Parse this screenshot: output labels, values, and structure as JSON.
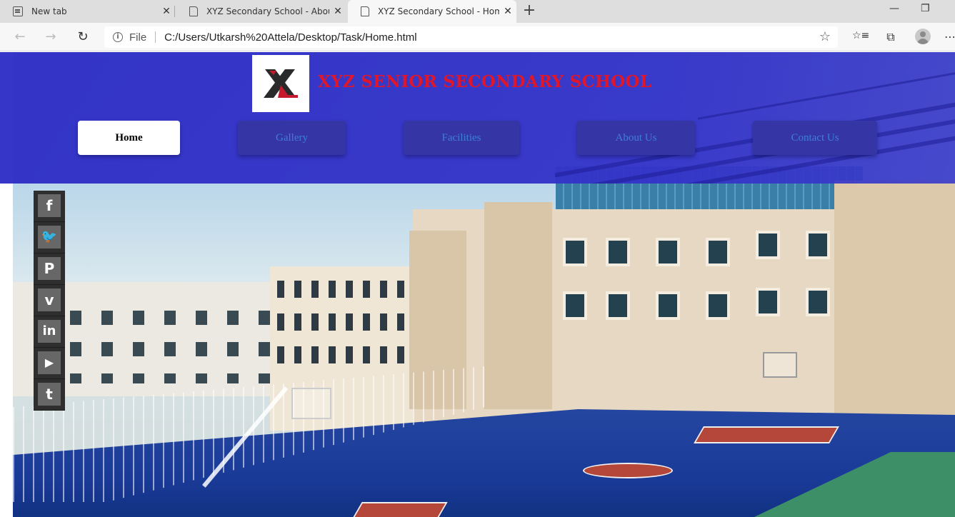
{
  "browser": {
    "tabs": [
      {
        "title": "New tab",
        "icon": "newtab-icon",
        "active": false
      },
      {
        "title": "XYZ Secondary School - About U",
        "icon": "document-icon",
        "active": false
      },
      {
        "title": "XYZ Secondary School - Home",
        "icon": "document-icon",
        "active": true
      }
    ],
    "new_tab": "+",
    "window_controls": {
      "minimize": "—",
      "restore": "❐"
    },
    "address_bar": {
      "scheme_label": "File",
      "url": "C:/Users/Utkarsh%20Attela/Desktop/Task/Home.html"
    },
    "icons": {
      "back": "←",
      "forward": "→",
      "reload": "↻",
      "info": "i",
      "star": "☆",
      "favorites": "☆≡",
      "collections": "⧉",
      "more": "⋯"
    }
  },
  "site": {
    "school_name": "XYZ SENIOR SECONDARY SCHOOL",
    "logo_alt_icon": "xyz-logo-icon",
    "nav": [
      {
        "label": "Home",
        "active": true
      },
      {
        "label": "Gallery",
        "active": false
      },
      {
        "label": "Facilities",
        "active": false
      },
      {
        "label": "About Us",
        "active": false
      },
      {
        "label": "Contact Us",
        "active": false
      }
    ],
    "social": [
      {
        "name": "facebook",
        "glyph": "f"
      },
      {
        "name": "twitter",
        "glyph": "🐦"
      },
      {
        "name": "pinterest",
        "glyph": "P"
      },
      {
        "name": "vimeo",
        "glyph": "v"
      },
      {
        "name": "linkedin",
        "glyph": "in"
      },
      {
        "name": "youtube",
        "glyph": "▶"
      },
      {
        "name": "tumblr",
        "glyph": "t"
      }
    ],
    "colors": {
      "header_bg": "#3232c6",
      "school_name": "#e0162b",
      "nav_text": "#3f7fd6",
      "nav_active_bg": "#ffffff"
    }
  }
}
